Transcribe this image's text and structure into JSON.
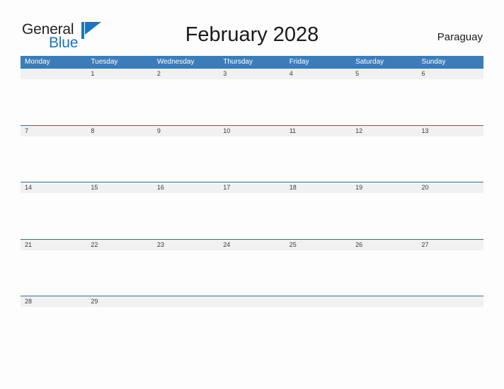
{
  "brand": {
    "name_primary": "General",
    "name_secondary": "Blue",
    "flag_icon": "flag-icon",
    "primary_color": "#231f20",
    "secondary_color": "#1b75bb"
  },
  "header": {
    "title": "February 2028",
    "country": "Paraguay"
  },
  "calendar": {
    "header_color": "#3b7db9",
    "band_color": "#f1f1f1",
    "separator_color": "#2f6fa8",
    "weekdays": [
      "Monday",
      "Tuesday",
      "Wednesday",
      "Thursday",
      "Friday",
      "Saturday",
      "Sunday"
    ],
    "weeks": [
      {
        "days": [
          {
            "date": ""
          },
          {
            "date": "1"
          },
          {
            "date": "2"
          },
          {
            "date": "3"
          },
          {
            "date": "4"
          },
          {
            "date": "5"
          },
          {
            "date": "6"
          }
        ]
      },
      {
        "days": [
          {
            "date": "7"
          },
          {
            "date": "8"
          },
          {
            "date": "9"
          },
          {
            "date": "10"
          },
          {
            "date": "11"
          },
          {
            "date": "12"
          },
          {
            "date": "13"
          }
        ]
      },
      {
        "days": [
          {
            "date": "14"
          },
          {
            "date": "15"
          },
          {
            "date": "16"
          },
          {
            "date": "17"
          },
          {
            "date": "18"
          },
          {
            "date": "19"
          },
          {
            "date": "20"
          }
        ]
      },
      {
        "days": [
          {
            "date": "21"
          },
          {
            "date": "22"
          },
          {
            "date": "23"
          },
          {
            "date": "24"
          },
          {
            "date": "25"
          },
          {
            "date": "26"
          },
          {
            "date": "27"
          }
        ]
      },
      {
        "days": [
          {
            "date": "28"
          },
          {
            "date": "29"
          },
          {
            "date": ""
          },
          {
            "date": ""
          },
          {
            "date": ""
          },
          {
            "date": ""
          },
          {
            "date": ""
          }
        ]
      }
    ]
  }
}
